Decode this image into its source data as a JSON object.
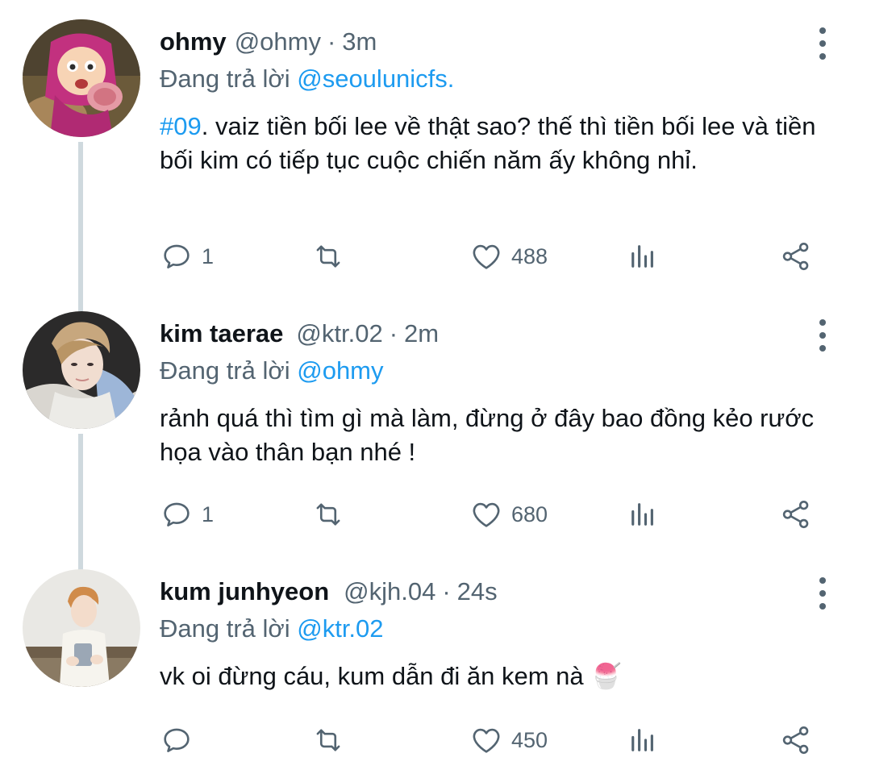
{
  "tweets": [
    {
      "name": "ohmy",
      "handle": "@ohmy",
      "time": "3m",
      "reply_prefix": "Đang trả lời ",
      "reply_to": "@seoulunicfs.",
      "hashtag": "#09",
      "text": ". vaiz tiền bối lee về thật sao? thế thì tiền bối lee và tiền bối kim có tiếp tục cuộc chiến năm ấy không nhỉ.",
      "replies": "1",
      "likes": "488",
      "avatar_icon": "cartoon-girl-avatar"
    },
    {
      "name": "kim taerae",
      "handle": "@ktr.02",
      "time": "2m",
      "reply_prefix": "Đang trả lời ",
      "reply_to": "@ohmy",
      "text": "rảnh quá thì tìm gì mà làm, đừng ở đây bao đồng kẻo rước họa vào thân bạn nhé !",
      "replies": "1",
      "likes": "680",
      "avatar_icon": "photo-avatar"
    },
    {
      "name": "kum junhyeon",
      "handle": "@kjh.04",
      "time": "24s",
      "reply_prefix": "Đang trả lời ",
      "reply_to": "@ktr.02",
      "text": "vk oi đừng cáu, kum dẫn đi ăn kem nà 🍧",
      "likes": "450",
      "avatar_icon": "photo-avatar"
    }
  ],
  "separator": "·",
  "colors": {
    "accent": "#1d9bf0",
    "muted": "#536471",
    "text": "#0f1419",
    "thread_line": "#cfd9de"
  }
}
